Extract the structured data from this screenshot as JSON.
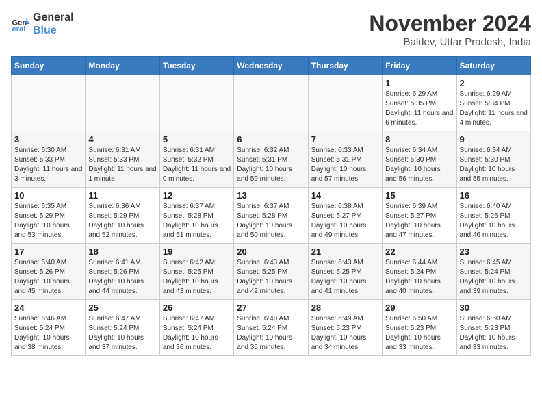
{
  "logo": {
    "line1": "General",
    "line2": "Blue"
  },
  "title": "November 2024",
  "location": "Baldev, Uttar Pradesh, India",
  "days_of_week": [
    "Sunday",
    "Monday",
    "Tuesday",
    "Wednesday",
    "Thursday",
    "Friday",
    "Saturday"
  ],
  "weeks": [
    [
      {
        "day": "",
        "info": ""
      },
      {
        "day": "",
        "info": ""
      },
      {
        "day": "",
        "info": ""
      },
      {
        "day": "",
        "info": ""
      },
      {
        "day": "",
        "info": ""
      },
      {
        "day": "1",
        "info": "Sunrise: 6:29 AM\nSunset: 5:35 PM\nDaylight: 11 hours and 6 minutes."
      },
      {
        "day": "2",
        "info": "Sunrise: 6:29 AM\nSunset: 5:34 PM\nDaylight: 11 hours and 4 minutes."
      }
    ],
    [
      {
        "day": "3",
        "info": "Sunrise: 6:30 AM\nSunset: 5:33 PM\nDaylight: 11 hours and 3 minutes."
      },
      {
        "day": "4",
        "info": "Sunrise: 6:31 AM\nSunset: 5:33 PM\nDaylight: 11 hours and 1 minute."
      },
      {
        "day": "5",
        "info": "Sunrise: 6:31 AM\nSunset: 5:32 PM\nDaylight: 11 hours and 0 minutes."
      },
      {
        "day": "6",
        "info": "Sunrise: 6:32 AM\nSunset: 5:31 PM\nDaylight: 10 hours and 59 minutes."
      },
      {
        "day": "7",
        "info": "Sunrise: 6:33 AM\nSunset: 5:31 PM\nDaylight: 10 hours and 57 minutes."
      },
      {
        "day": "8",
        "info": "Sunrise: 6:34 AM\nSunset: 5:30 PM\nDaylight: 10 hours and 56 minutes."
      },
      {
        "day": "9",
        "info": "Sunrise: 6:34 AM\nSunset: 5:30 PM\nDaylight: 10 hours and 55 minutes."
      }
    ],
    [
      {
        "day": "10",
        "info": "Sunrise: 6:35 AM\nSunset: 5:29 PM\nDaylight: 10 hours and 53 minutes."
      },
      {
        "day": "11",
        "info": "Sunrise: 6:36 AM\nSunset: 5:29 PM\nDaylight: 10 hours and 52 minutes."
      },
      {
        "day": "12",
        "info": "Sunrise: 6:37 AM\nSunset: 5:28 PM\nDaylight: 10 hours and 51 minutes."
      },
      {
        "day": "13",
        "info": "Sunrise: 6:37 AM\nSunset: 5:28 PM\nDaylight: 10 hours and 50 minutes."
      },
      {
        "day": "14",
        "info": "Sunrise: 6:38 AM\nSunset: 5:27 PM\nDaylight: 10 hours and 49 minutes."
      },
      {
        "day": "15",
        "info": "Sunrise: 6:39 AM\nSunset: 5:27 PM\nDaylight: 10 hours and 47 minutes."
      },
      {
        "day": "16",
        "info": "Sunrise: 6:40 AM\nSunset: 5:26 PM\nDaylight: 10 hours and 46 minutes."
      }
    ],
    [
      {
        "day": "17",
        "info": "Sunrise: 6:40 AM\nSunset: 5:26 PM\nDaylight: 10 hours and 45 minutes."
      },
      {
        "day": "18",
        "info": "Sunrise: 6:41 AM\nSunset: 5:26 PM\nDaylight: 10 hours and 44 minutes."
      },
      {
        "day": "19",
        "info": "Sunrise: 6:42 AM\nSunset: 5:25 PM\nDaylight: 10 hours and 43 minutes."
      },
      {
        "day": "20",
        "info": "Sunrise: 6:43 AM\nSunset: 5:25 PM\nDaylight: 10 hours and 42 minutes."
      },
      {
        "day": "21",
        "info": "Sunrise: 6:43 AM\nSunset: 5:25 PM\nDaylight: 10 hours and 41 minutes."
      },
      {
        "day": "22",
        "info": "Sunrise: 6:44 AM\nSunset: 5:24 PM\nDaylight: 10 hours and 40 minutes."
      },
      {
        "day": "23",
        "info": "Sunrise: 6:45 AM\nSunset: 5:24 PM\nDaylight: 10 hours and 39 minutes."
      }
    ],
    [
      {
        "day": "24",
        "info": "Sunrise: 6:46 AM\nSunset: 5:24 PM\nDaylight: 10 hours and 38 minutes."
      },
      {
        "day": "25",
        "info": "Sunrise: 6:47 AM\nSunset: 5:24 PM\nDaylight: 10 hours and 37 minutes."
      },
      {
        "day": "26",
        "info": "Sunrise: 6:47 AM\nSunset: 5:24 PM\nDaylight: 10 hours and 36 minutes."
      },
      {
        "day": "27",
        "info": "Sunrise: 6:48 AM\nSunset: 5:24 PM\nDaylight: 10 hours and 35 minutes."
      },
      {
        "day": "28",
        "info": "Sunrise: 6:49 AM\nSunset: 5:23 PM\nDaylight: 10 hours and 34 minutes."
      },
      {
        "day": "29",
        "info": "Sunrise: 6:50 AM\nSunset: 5:23 PM\nDaylight: 10 hours and 33 minutes."
      },
      {
        "day": "30",
        "info": "Sunrise: 6:50 AM\nSunset: 5:23 PM\nDaylight: 10 hours and 33 minutes."
      }
    ]
  ]
}
